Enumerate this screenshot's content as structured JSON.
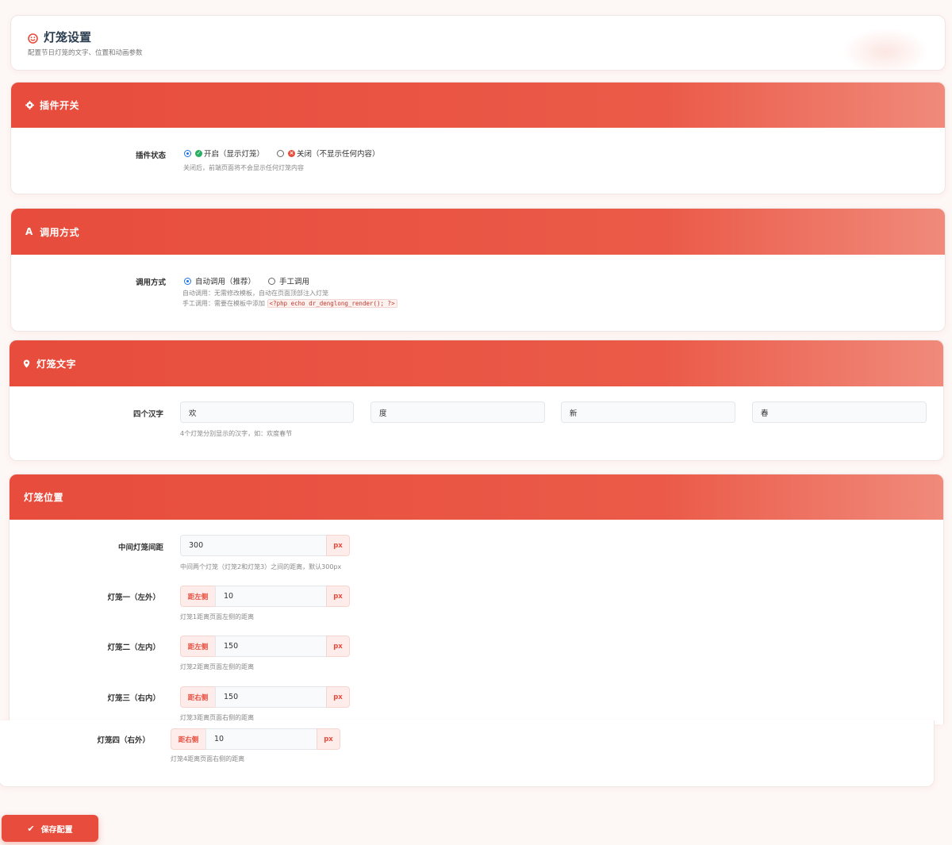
{
  "page": {
    "title": "灯笼设置",
    "subtitle": "配置节日灯笼的文字、位置和动画参数",
    "icon": "smiley-icon"
  },
  "sections": {
    "plugin": {
      "title": "插件开关",
      "icon": "gear-icon",
      "status_label": "插件状态",
      "option_on": "开启（显示灯笼）",
      "option_off": "关闭（不显示任何内容）",
      "selected": "on",
      "hint": "关闭后，前端页面将不会显示任何灯笼内容"
    },
    "invoke": {
      "title": "调用方式",
      "icon": "font-a-icon",
      "label": "调用方式",
      "option_auto": "自动调用（推荐）",
      "option_manual": "手工调用",
      "selected": "auto",
      "hint_auto": "自动调用：无需修改模板，自动在页面顶部注入灯笼",
      "hint_manual": "手工调用：需要在模板中添加",
      "code": "<?php echo dr_denglong_render(); ?>"
    },
    "text": {
      "title": "灯笼文字",
      "icon": "map-pin-icon",
      "label": "四个汉字",
      "chars": [
        "欢",
        "度",
        "新",
        "春"
      ],
      "hint": "4个灯笼分别显示的汉字，如：欢度春节"
    },
    "position": {
      "title": "灯笼位置",
      "unit": "px",
      "gap_label": "中间灯笼间距",
      "gap_value": "300",
      "gap_hint": "中间两个灯笼（灯笼2和灯笼3）之间的距离，默认300px",
      "lantern1_label": "灯笼一（左外）",
      "lantern1_side": "距左侧",
      "lantern1_value": "10",
      "lantern1_hint": "灯笼1距离页面左侧的距离",
      "lantern2_label": "灯笼二（左内）",
      "lantern2_side": "距左侧",
      "lantern2_value": "150",
      "lantern2_hint": "灯笼2距离页面左侧的距离",
      "lantern3_label": "灯笼三（右内）",
      "lantern3_side": "距右侧",
      "lantern3_value": "150",
      "lantern3_hint": "灯笼3距离页面右侧的距离",
      "lantern4_label": "灯笼四（右外）",
      "lantern4_side": "距右侧",
      "lantern4_value": "10",
      "lantern4_hint": "灯笼4距离页面右侧的距离"
    }
  },
  "save_button": "保存配置",
  "colors": {
    "accent": "#e74c3c",
    "success": "#27ae60"
  }
}
